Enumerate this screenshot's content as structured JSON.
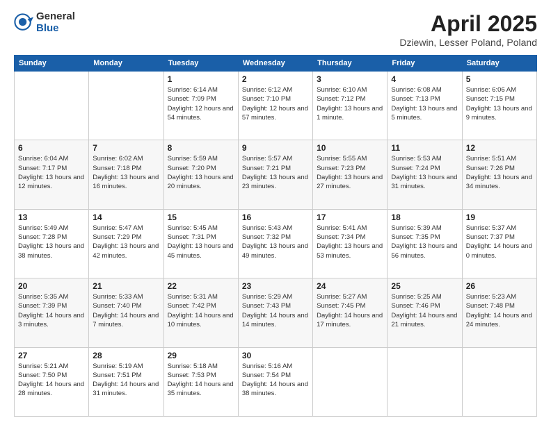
{
  "header": {
    "logo_general": "General",
    "logo_blue": "Blue",
    "month": "April 2025",
    "location": "Dziewin, Lesser Poland, Poland"
  },
  "weekdays": [
    "Sunday",
    "Monday",
    "Tuesday",
    "Wednesday",
    "Thursday",
    "Friday",
    "Saturday"
  ],
  "weeks": [
    [
      null,
      null,
      {
        "day": 1,
        "sunrise": "6:14 AM",
        "sunset": "7:09 PM",
        "daylight": "12 hours and 54 minutes."
      },
      {
        "day": 2,
        "sunrise": "6:12 AM",
        "sunset": "7:10 PM",
        "daylight": "12 hours and 57 minutes."
      },
      {
        "day": 3,
        "sunrise": "6:10 AM",
        "sunset": "7:12 PM",
        "daylight": "13 hours and 1 minute."
      },
      {
        "day": 4,
        "sunrise": "6:08 AM",
        "sunset": "7:13 PM",
        "daylight": "13 hours and 5 minutes."
      },
      {
        "day": 5,
        "sunrise": "6:06 AM",
        "sunset": "7:15 PM",
        "daylight": "13 hours and 9 minutes."
      }
    ],
    [
      {
        "day": 6,
        "sunrise": "6:04 AM",
        "sunset": "7:17 PM",
        "daylight": "13 hours and 12 minutes."
      },
      {
        "day": 7,
        "sunrise": "6:02 AM",
        "sunset": "7:18 PM",
        "daylight": "13 hours and 16 minutes."
      },
      {
        "day": 8,
        "sunrise": "5:59 AM",
        "sunset": "7:20 PM",
        "daylight": "13 hours and 20 minutes."
      },
      {
        "day": 9,
        "sunrise": "5:57 AM",
        "sunset": "7:21 PM",
        "daylight": "13 hours and 23 minutes."
      },
      {
        "day": 10,
        "sunrise": "5:55 AM",
        "sunset": "7:23 PM",
        "daylight": "13 hours and 27 minutes."
      },
      {
        "day": 11,
        "sunrise": "5:53 AM",
        "sunset": "7:24 PM",
        "daylight": "13 hours and 31 minutes."
      },
      {
        "day": 12,
        "sunrise": "5:51 AM",
        "sunset": "7:26 PM",
        "daylight": "13 hours and 34 minutes."
      }
    ],
    [
      {
        "day": 13,
        "sunrise": "5:49 AM",
        "sunset": "7:28 PM",
        "daylight": "13 hours and 38 minutes."
      },
      {
        "day": 14,
        "sunrise": "5:47 AM",
        "sunset": "7:29 PM",
        "daylight": "13 hours and 42 minutes."
      },
      {
        "day": 15,
        "sunrise": "5:45 AM",
        "sunset": "7:31 PM",
        "daylight": "13 hours and 45 minutes."
      },
      {
        "day": 16,
        "sunrise": "5:43 AM",
        "sunset": "7:32 PM",
        "daylight": "13 hours and 49 minutes."
      },
      {
        "day": 17,
        "sunrise": "5:41 AM",
        "sunset": "7:34 PM",
        "daylight": "13 hours and 53 minutes."
      },
      {
        "day": 18,
        "sunrise": "5:39 AM",
        "sunset": "7:35 PM",
        "daylight": "13 hours and 56 minutes."
      },
      {
        "day": 19,
        "sunrise": "5:37 AM",
        "sunset": "7:37 PM",
        "daylight": "14 hours and 0 minutes."
      }
    ],
    [
      {
        "day": 20,
        "sunrise": "5:35 AM",
        "sunset": "7:39 PM",
        "daylight": "14 hours and 3 minutes."
      },
      {
        "day": 21,
        "sunrise": "5:33 AM",
        "sunset": "7:40 PM",
        "daylight": "14 hours and 7 minutes."
      },
      {
        "day": 22,
        "sunrise": "5:31 AM",
        "sunset": "7:42 PM",
        "daylight": "14 hours and 10 minutes."
      },
      {
        "day": 23,
        "sunrise": "5:29 AM",
        "sunset": "7:43 PM",
        "daylight": "14 hours and 14 minutes."
      },
      {
        "day": 24,
        "sunrise": "5:27 AM",
        "sunset": "7:45 PM",
        "daylight": "14 hours and 17 minutes."
      },
      {
        "day": 25,
        "sunrise": "5:25 AM",
        "sunset": "7:46 PM",
        "daylight": "14 hours and 21 minutes."
      },
      {
        "day": 26,
        "sunrise": "5:23 AM",
        "sunset": "7:48 PM",
        "daylight": "14 hours and 24 minutes."
      }
    ],
    [
      {
        "day": 27,
        "sunrise": "5:21 AM",
        "sunset": "7:50 PM",
        "daylight": "14 hours and 28 minutes."
      },
      {
        "day": 28,
        "sunrise": "5:19 AM",
        "sunset": "7:51 PM",
        "daylight": "14 hours and 31 minutes."
      },
      {
        "day": 29,
        "sunrise": "5:18 AM",
        "sunset": "7:53 PM",
        "daylight": "14 hours and 35 minutes."
      },
      {
        "day": 30,
        "sunrise": "5:16 AM",
        "sunset": "7:54 PM",
        "daylight": "14 hours and 38 minutes."
      },
      null,
      null,
      null
    ]
  ]
}
